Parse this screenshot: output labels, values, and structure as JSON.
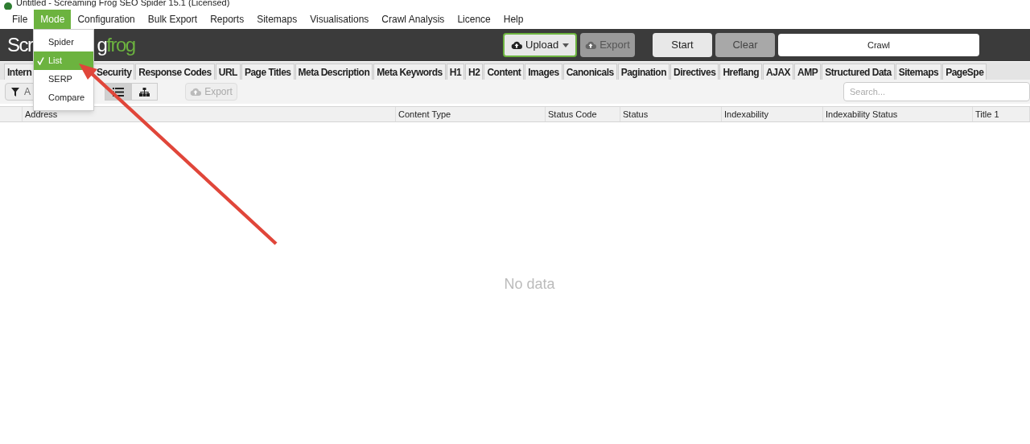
{
  "window": {
    "title": "Untitled - Screaming Frog SEO Spider 15.1 (Licensed)"
  },
  "menu_bar": [
    {
      "label": "File",
      "selected": false
    },
    {
      "label": "Mode",
      "selected": true
    },
    {
      "label": "Configuration",
      "selected": false
    },
    {
      "label": "Bulk Export",
      "selected": false
    },
    {
      "label": "Reports",
      "selected": false
    },
    {
      "label": "Sitemaps",
      "selected": false
    },
    {
      "label": "Visualisations",
      "selected": false
    },
    {
      "label": "Crawl Analysis",
      "selected": false
    },
    {
      "label": "Licence",
      "selected": false
    },
    {
      "label": "Help",
      "selected": false
    }
  ],
  "mode_menu": [
    {
      "label": "Spider",
      "selected": false
    },
    {
      "label": "List",
      "selected": true
    },
    {
      "label": "SERP",
      "selected": false
    },
    {
      "label": "Compare",
      "selected": false
    }
  ],
  "logo": {
    "left": "Scr",
    "middle": "g",
    "right": "frog"
  },
  "header": {
    "upload": "Upload",
    "export": "Export",
    "start": "Start",
    "clear": "Clear",
    "url_field": "Crawl"
  },
  "tabs": [
    "Intern",
    "Security",
    "Response Codes",
    "URL",
    "Page Titles",
    "Meta Description",
    "Meta Keywords",
    "H1",
    "H2",
    "Content",
    "Images",
    "Canonicals",
    "Pagination",
    "Directives",
    "Hreflang",
    "AJAX",
    "AMP",
    "Structured Data",
    "Sitemaps",
    "PageSpe"
  ],
  "toolbar": {
    "filter": "A",
    "view_modes": [
      {
        "kind": "list",
        "selected": true
      },
      {
        "kind": "tree",
        "selected": false
      }
    ],
    "export": "Export",
    "search": {
      "placeholder": "Search..."
    }
  },
  "table": {
    "columns": [
      "Address",
      "Content Type",
      "Status Code",
      "Status",
      "Indexability",
      "Indexability Status",
      "Title 1"
    ],
    "empty_text": "No data"
  }
}
